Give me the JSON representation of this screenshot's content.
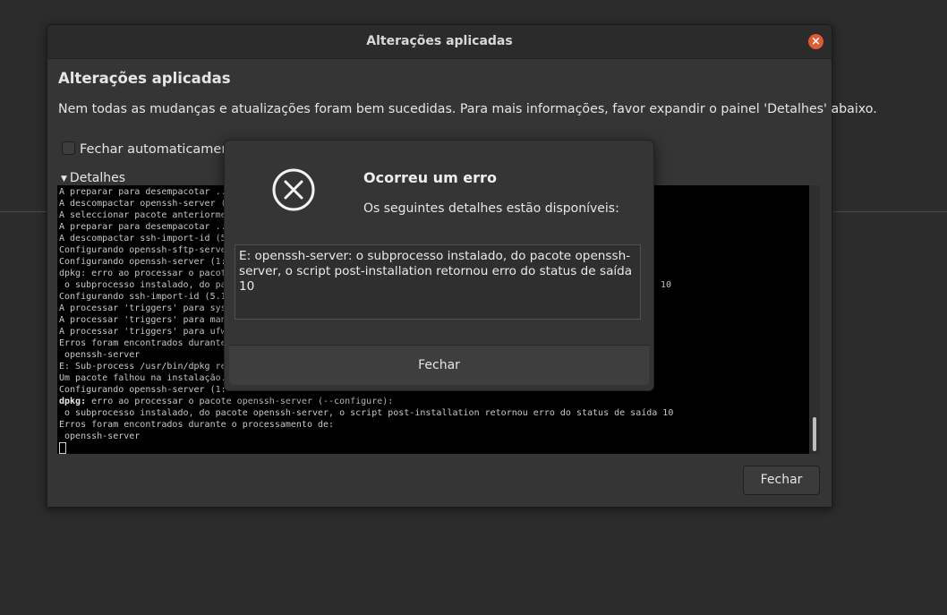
{
  "window": {
    "title": "Alterações aplicadas",
    "heading": "Alterações aplicadas",
    "message": "Nem todas as mudanças e atualizações foram bem sucedidas. Para mais informações, favor expandir o painel 'Detalhes' abaixo.",
    "auto_close_label": "Fechar automaticament",
    "details_label": "Detalhes",
    "close_button": "Fechar",
    "close_icon": "×"
  },
  "terminal": {
    "lines": [
      "A preparar para desempacotar ...",
      "A descompactar openssh-server (",
      "A seleccionar pacote anteriorme",
      "A preparar para desempacotar ..",
      "A descompactar ssh-import-id (5",
      "Configurando openssh-sftp-serve",
      "Configurando openssh-server (1:",
      "dpkg: erro ao processar o pacot",
      " o subprocesso instalado, do pa",
      "Configurando ssh-import-id (5.1",
      "A processar 'triggers' para sys",
      "A processar 'triggers' para man",
      "A processar 'triggers' para ufw",
      "Erros foram encontrados durante",
      " openssh-server",
      "E: Sub-process /usr/bin/dpkg re",
      "Um pacote falhou na instalação.",
      "Configurando openssh-server (1:"
    ],
    "line_8_tail": "10",
    "bold_prefix": "dpkg:",
    "tail_lines": [
      " erro ao processar o pacote openssh-server (--configure):",
      " o subprocesso instalado, do pacote openssh-server, o script post-installation retornou erro do status de saída 10",
      "Erros foram encontrados durante o processamento de:",
      " openssh-server"
    ]
  },
  "error_dialog": {
    "title": "Ocorreu um erro",
    "subtitle": "Os seguintes detalhes estão disponíveis:",
    "details": "E: openssh-server: o subprocesso instalado, do pacote openssh-server, o script post-installation retornou erro do status de saída 10",
    "close_button": "Fechar",
    "icon": "error-circle-x-icon"
  }
}
